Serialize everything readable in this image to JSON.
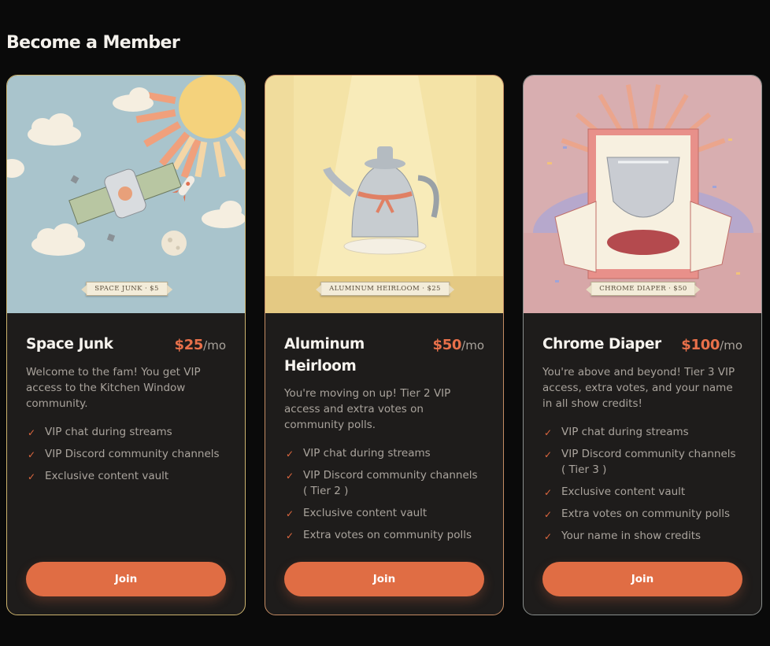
{
  "page": {
    "title": "Become a Member"
  },
  "colors": {
    "accent": "#e06d44",
    "background": "#0a0a0a",
    "card": "#1e1c1b"
  },
  "tiers": [
    {
      "name": "Space Junk",
      "price": "$25",
      "per": "/mo",
      "image_label": "SPACE JUNK · $5",
      "description": "Welcome to the fam! You get VIP access to the Kitchen Window community.",
      "features": [
        "VIP chat during streams",
        "VIP Discord community channels",
        "Exclusive content vault"
      ],
      "button": "Join"
    },
    {
      "name": "Aluminum Heirloom",
      "price": "$50",
      "per": "/mo",
      "image_label": "ALUMINUM HEIRLOOM · $25",
      "description": "You're moving on up! Tier 2 VIP access and extra votes on community polls.",
      "features": [
        "VIP chat during streams",
        "VIP Discord community channels ( Tier 2 )",
        "Exclusive content vault",
        "Extra votes on community polls"
      ],
      "button": "Join"
    },
    {
      "name": "Chrome Diaper",
      "price": "$100",
      "per": "/mo",
      "image_label": "CHROME DIAPER · $50",
      "description": "You're above and beyond! Tier 3 VIP access, extra votes, and your name in all show credits!",
      "features": [
        "VIP chat during streams",
        "VIP Discord community channels ( Tier 3 )",
        "Exclusive content vault",
        "Extra votes on community polls",
        "Your name in show credits"
      ],
      "button": "Join"
    }
  ]
}
